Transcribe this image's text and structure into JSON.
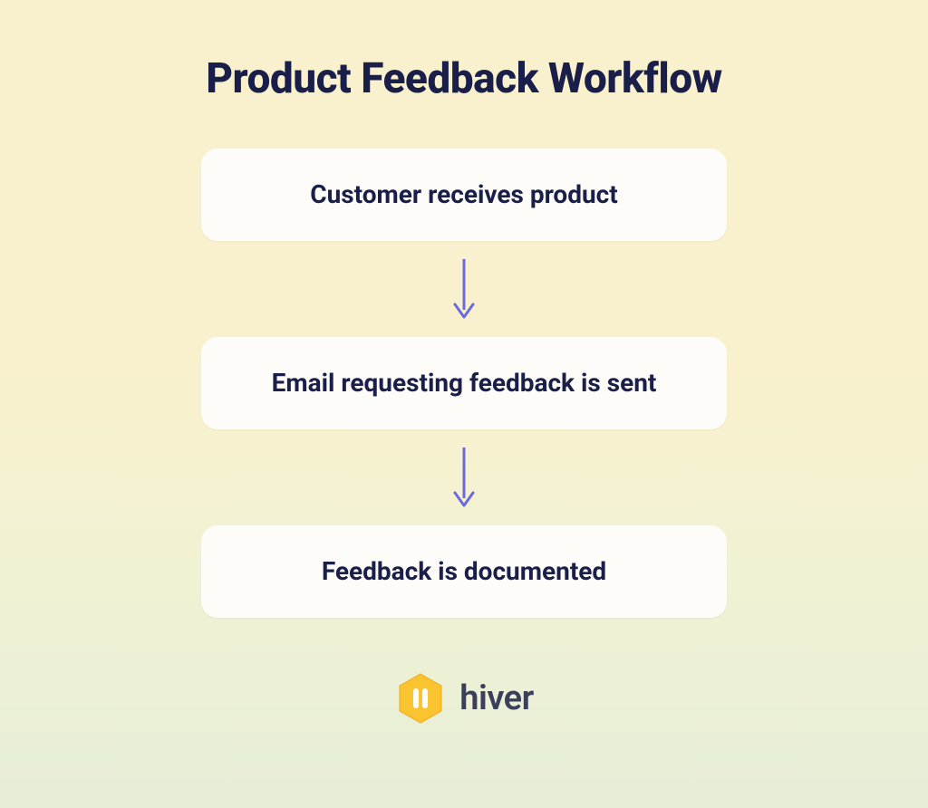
{
  "title": "Product Feedback Workflow",
  "steps": [
    {
      "label": "Customer receives product"
    },
    {
      "label": "Email requesting feedback is sent"
    },
    {
      "label": "Feedback is documented"
    }
  ],
  "brand": {
    "name": "hiver"
  },
  "colors": {
    "text": "#1a1f4a",
    "arrow": "#6b6ae0",
    "boxBg": "#fdfcf9",
    "hexagon": "#f9c430",
    "hexagonStroke": "#f0a818"
  }
}
